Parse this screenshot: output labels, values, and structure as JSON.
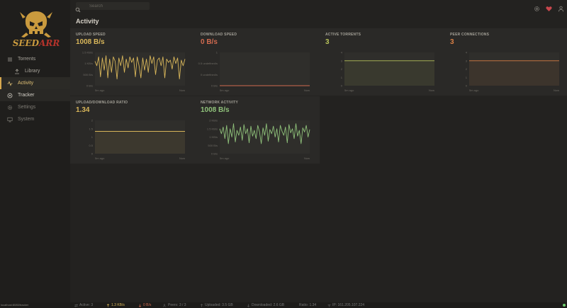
{
  "app": {
    "name": "SEEDARR"
  },
  "search": {
    "placeholder": "Search"
  },
  "nav": [
    {
      "label": "Torrents",
      "icon": "torrents-icon"
    },
    {
      "label": "Library",
      "icon": "library-icon"
    },
    {
      "label": "Activity",
      "icon": "activity-icon"
    },
    {
      "label": "Tracker",
      "icon": "tracker-icon"
    },
    {
      "label": "Settings",
      "icon": "gear-icon"
    },
    {
      "label": "System",
      "icon": "monitor-icon"
    }
  ],
  "page": {
    "title": "Activity"
  },
  "cards": [
    {
      "label": "UPLOAD SPEED",
      "value": "1008 B/s",
      "color": "#d8b65a",
      "yticks": [
        "1.5 KB/s",
        "1 KB/s",
        "500 B/s",
        "0 B/s"
      ],
      "xstart": "5m ago",
      "xend": "Now"
    },
    {
      "label": "DOWNLOAD SPEED",
      "value": "0 B/s",
      "color": "#d06a4f",
      "yticks": [
        "1",
        "0.5 undefined/s",
        "0 undefined/s",
        "0 B/s"
      ],
      "xstart": "5m ago",
      "xend": "Now"
    },
    {
      "label": "ACTIVE TORRENTS",
      "value": "3",
      "color": "#b8c25a",
      "yticks": [
        "4",
        "3",
        "2",
        "1",
        "0"
      ],
      "xstart": "5m ago",
      "xend": "Now"
    },
    {
      "label": "PEER CONNECTIONS",
      "value": "3",
      "color": "#d97f45",
      "yticks": [
        "4",
        "3",
        "2",
        "1",
        "0"
      ],
      "xstart": "5m ago",
      "xend": "Now"
    },
    {
      "label": "UPLOAD/DOWNLOAD RATIO",
      "value": "1.34",
      "color": "#d8b65a",
      "yticks": [
        "2",
        "1.5",
        "1",
        "0.5",
        "0"
      ],
      "xstart": "5m ago",
      "xend": "Now"
    },
    {
      "label": "NETWORK ACTIVITY",
      "value": "1008 B/s",
      "color": "#8fc17a",
      "yticks": [
        "2 KB/s",
        "1.5 KB/s",
        "1 KB/s",
        "500 B/s",
        "0 B/s"
      ],
      "xstart": "5m ago",
      "xend": "Now"
    }
  ],
  "chart_data": [
    {
      "type": "line",
      "title": "UPLOAD SPEED",
      "ylim": [
        0,
        1500
      ],
      "values": [
        1100,
        900,
        1300,
        400,
        1250,
        700,
        1350,
        350,
        1200,
        600,
        1300,
        1100,
        300,
        1250,
        900,
        1350,
        600,
        1200,
        800,
        1300,
        1050,
        1250,
        400,
        1300,
        900,
        350,
        1250,
        700,
        1200,
        600,
        1350,
        1000,
        1300,
        500,
        1150,
        1250,
        900,
        1300,
        350,
        1200,
        1050,
        1150,
        750,
        1300,
        1000,
        1250,
        300,
        1150,
        900,
        1200
      ]
    },
    {
      "type": "line",
      "title": "DOWNLOAD SPEED",
      "ylim": [
        0,
        1
      ],
      "values": [
        0,
        0
      ]
    },
    {
      "type": "area",
      "title": "ACTIVE TORRENTS",
      "ylim": [
        0,
        4
      ],
      "values": [
        3,
        3
      ]
    },
    {
      "type": "area",
      "title": "PEER CONNECTIONS",
      "ylim": [
        0,
        4
      ],
      "values": [
        3,
        3
      ]
    },
    {
      "type": "area",
      "title": "UPLOAD/DOWNLOAD RATIO",
      "ylim": [
        0,
        2
      ],
      "values": [
        1.34,
        1.34
      ]
    },
    {
      "type": "line",
      "title": "NETWORK ACTIVITY",
      "ylim": [
        0,
        2000
      ],
      "values": [
        1500,
        1200,
        1600,
        900,
        1700,
        600,
        1500,
        1000,
        1800,
        700,
        1400,
        1100,
        1600,
        800,
        1750,
        1200,
        1500,
        650,
        1650,
        1050,
        1400,
        900,
        1700,
        1300,
        600,
        1550,
        1100,
        1800,
        750,
        1450,
        1200,
        1650,
        1000,
        1500,
        700,
        1700,
        1350,
        1100,
        1600,
        650,
        1750,
        1250,
        1500,
        900,
        1800,
        1050,
        1400,
        600,
        1550,
        1300,
        1700,
        1000,
        1450
      ]
    }
  ],
  "statusbar": {
    "url": "localhost:8080/tracker",
    "active": "Active: 3",
    "upload": "1.3 KB/s",
    "download": "0 B/s",
    "peers": "Peers: 3 / 3",
    "uploaded": "Uploaded: 3.5 GB",
    "downloaded": "Downloaded: 2.6 GB",
    "ratio": "Ratio: 1.34",
    "ip": "IP: 161.205.107.224",
    "colors": {
      "upload": "#d8b65a",
      "download": "#d06a4f",
      "online": "#6fd06f"
    }
  }
}
